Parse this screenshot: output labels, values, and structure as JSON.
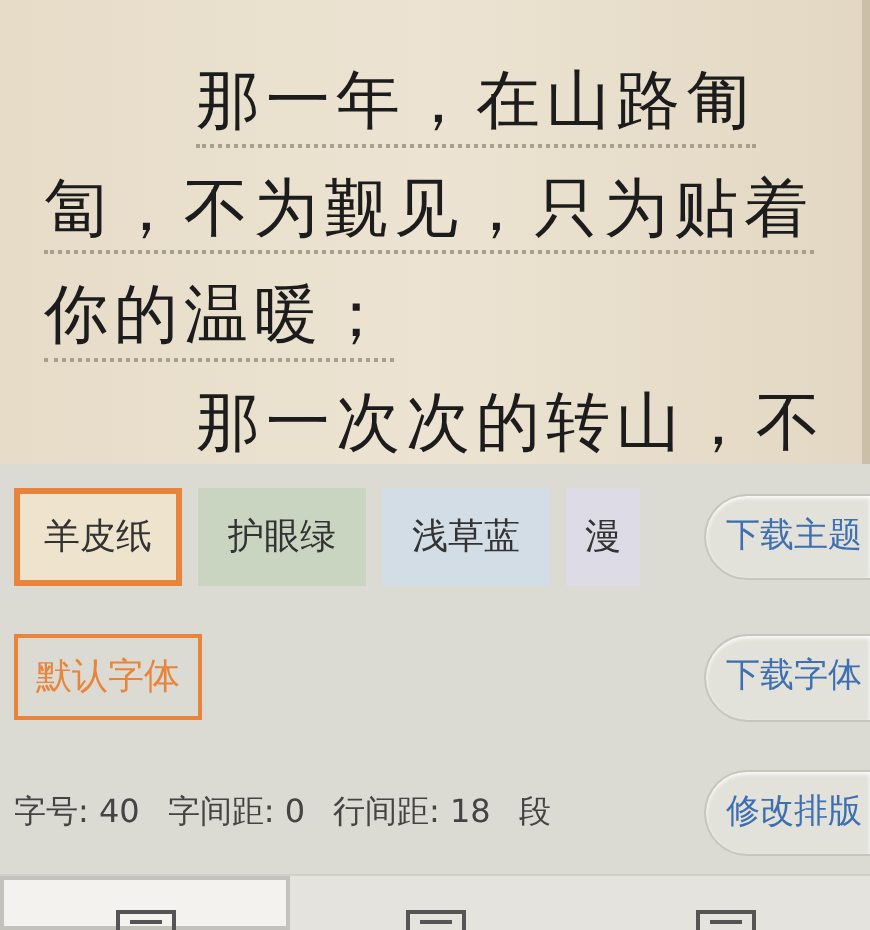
{
  "reader": {
    "lines": [
      {
        "text": "那一年，在山路匍",
        "indent": true
      },
      {
        "text": "匐，不为觐见，只为贴着",
        "indent": false
      },
      {
        "text": "你的温暖；",
        "indent": false
      },
      {
        "text": "那一次次的转山，不",
        "indent": true
      }
    ]
  },
  "themes": [
    {
      "label": "羊皮纸",
      "selected": true,
      "color": "#eee3cd"
    },
    {
      "label": "护眼绿",
      "selected": false,
      "color": "#c9d5c0"
    },
    {
      "label": "浅草蓝",
      "selected": false,
      "color": "#d3dde6"
    },
    {
      "label": "漫",
      "selected": false,
      "color": "#dcdbe6"
    }
  ],
  "download_theme_button": "下载主题",
  "fonts": [
    {
      "label": "默认字体",
      "selected": true
    }
  ],
  "download_font_button": "下载字体",
  "layout_stats": [
    "字号: 40",
    "字间距: 0",
    "行间距: 18",
    "段"
  ],
  "edit_layout_button": "修改排版",
  "bottom_tabs": [
    {
      "selected": true
    },
    {
      "selected": false
    },
    {
      "selected": false
    }
  ]
}
